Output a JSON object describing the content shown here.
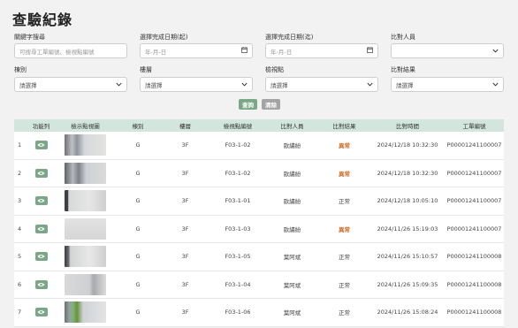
{
  "page": {
    "title": "查驗紀錄"
  },
  "filters": {
    "keyword": {
      "label": "關鍵字搜尋",
      "placeholder": "可搜尋工單編號、檢視點編號"
    },
    "date_start": {
      "label": "選擇完成日期(起)",
      "placeholder": "年-月-日"
    },
    "date_end": {
      "label": "選擇完成日期(迄)",
      "placeholder": "年-月-日"
    },
    "person": {
      "label": "比對人員",
      "value": ""
    },
    "building": {
      "label": "棟別",
      "value": "請選擇"
    },
    "floor": {
      "label": "樓層",
      "value": "請選擇"
    },
    "checkpoint": {
      "label": "檢視點",
      "value": "請選擇"
    },
    "result": {
      "label": "比對結果",
      "value": "請選擇"
    }
  },
  "actions": {
    "search_label": "查詢",
    "clear_label": "清除"
  },
  "table": {
    "headers": [
      "",
      "功能列",
      "檢示點視圖",
      "棟別",
      "樓層",
      "檢視點編號",
      "比對人員",
      "比對結果",
      "比對時間",
      "工單編號"
    ],
    "rows": [
      {
        "no": "1",
        "building": "G",
        "floor": "3F",
        "checkpoint": "F03-1-02",
        "person": "歐繡紛",
        "result": "異常",
        "time": "2024/12/18 10:32:30",
        "order": "P00001241100007"
      },
      {
        "no": "2",
        "building": "G",
        "floor": "3F",
        "checkpoint": "F03-1-02",
        "person": "歐繡紛",
        "result": "異常",
        "time": "2024/12/18 10:32:30",
        "order": "P00001241100007"
      },
      {
        "no": "3",
        "building": "G",
        "floor": "3F",
        "checkpoint": "F03-1-01",
        "person": "歐繡紛",
        "result": "正常",
        "time": "2024/12/18 10:05:10",
        "order": "P00001241100007"
      },
      {
        "no": "4",
        "building": "G",
        "floor": "3F",
        "checkpoint": "F03-1-03",
        "person": "歐繡紛",
        "result": "異常",
        "time": "2024/11/26 15:19:03",
        "order": "P00001241100007"
      },
      {
        "no": "5",
        "building": "G",
        "floor": "3F",
        "checkpoint": "F03-1-05",
        "person": "葉阿斌",
        "result": "正常",
        "time": "2024/11/26 15:10:57",
        "order": "P00001241100008"
      },
      {
        "no": "6",
        "building": "G",
        "floor": "3F",
        "checkpoint": "F03-1-04",
        "person": "葉阿斌",
        "result": "正常",
        "time": "2024/11/26 15:09:35",
        "order": "P00001241100008"
      },
      {
        "no": "7",
        "building": "G",
        "floor": "3F",
        "checkpoint": "F03-1-06",
        "person": "葉阿斌",
        "result": "正常",
        "time": "2024/11/26 15:08:24",
        "order": "P00001241100008"
      }
    ]
  },
  "icons": {
    "view": "eye-icon",
    "calendar": "calendar-icon",
    "dropdown": "chevron-down-icon"
  },
  "colors": {
    "accent": "#7aa887",
    "header_bg": "#d3e6de",
    "abnormal": "#d06a25",
    "clear": "#a4a4a4"
  }
}
